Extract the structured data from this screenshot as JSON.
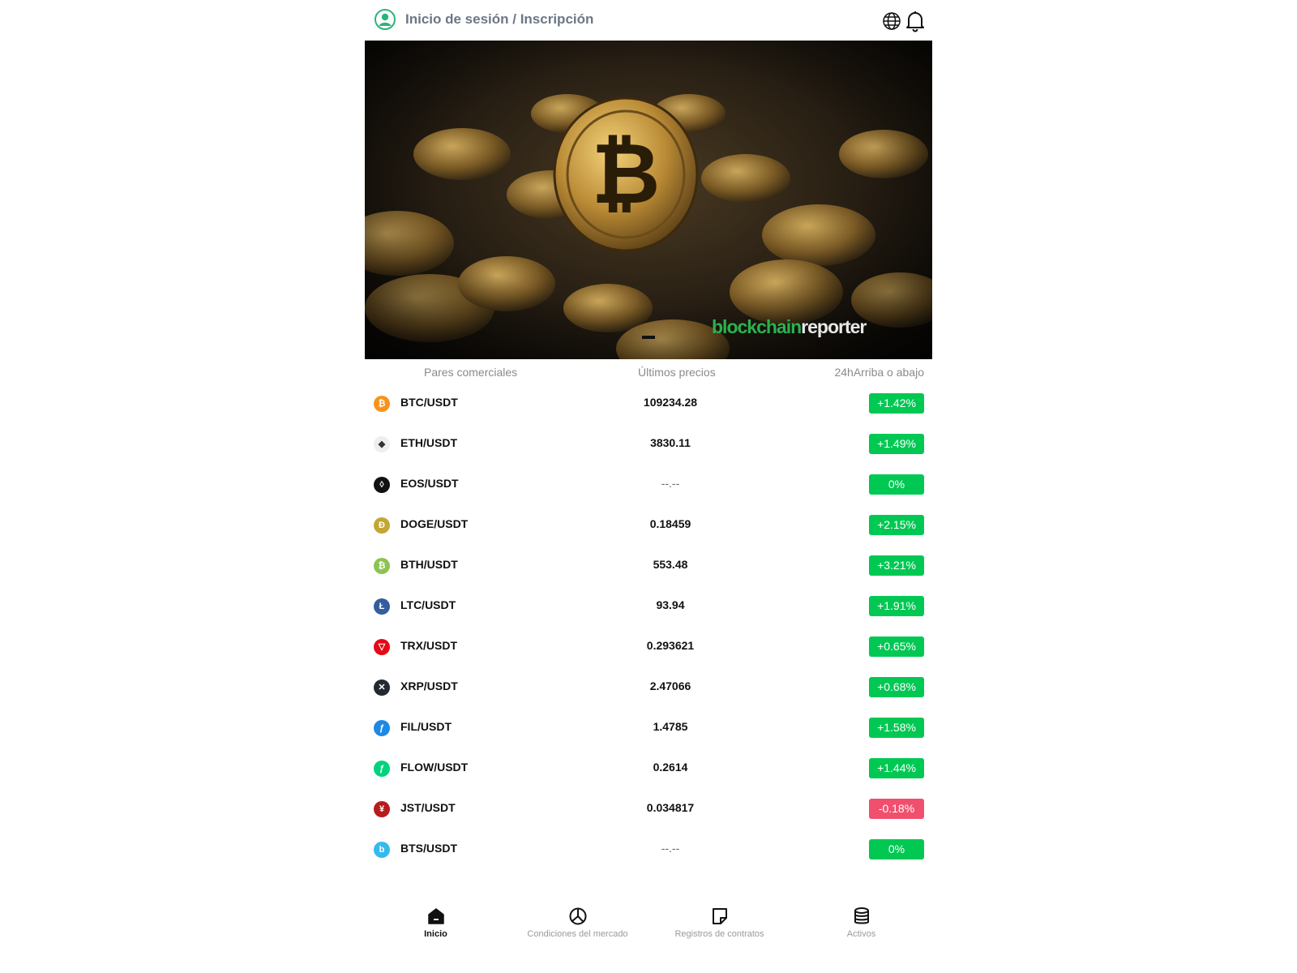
{
  "header": {
    "login_label": "Inicio de sesión / Inscripción",
    "avatar_icon": "user-circle-icon",
    "language_icon": "globe-icon",
    "notifications_icon": "bell-icon"
  },
  "banner": {
    "watermark_part1": "blockchain",
    "watermark_part2": "reporter"
  },
  "table": {
    "col_pair": "Pares comerciales",
    "col_price": "Últimos precios",
    "col_change": "24hArriba o abajo",
    "rows": [
      {
        "pair": "BTC/USDT",
        "price": "109234.28",
        "change": "+1.42%",
        "dir": "up",
        "icon": "bitcoin-icon",
        "glyph": "₿",
        "color": "#f7931a"
      },
      {
        "pair": "ETH/USDT",
        "price": "3830.11",
        "change": "+1.49%",
        "dir": "up",
        "icon": "ethereum-icon",
        "glyph": "◆",
        "color": "#eeeeee"
      },
      {
        "pair": "EOS/USDT",
        "price": "--.--",
        "change": "0%",
        "dir": "up",
        "icon": "eos-icon",
        "glyph": "◊",
        "color": "#111111"
      },
      {
        "pair": "DOGE/USDT",
        "price": "0.18459",
        "change": "+2.15%",
        "dir": "up",
        "icon": "dogecoin-icon",
        "glyph": "Ð",
        "color": "#c3a634"
      },
      {
        "pair": "BTH/USDT",
        "price": "553.48",
        "change": "+3.21%",
        "dir": "up",
        "icon": "bitcoin-cash-icon",
        "glyph": "₿",
        "color": "#8dc351"
      },
      {
        "pair": "LTC/USDT",
        "price": "93.94",
        "change": "+1.91%",
        "dir": "up",
        "icon": "litecoin-icon",
        "glyph": "Ł",
        "color": "#345d9d"
      },
      {
        "pair": "TRX/USDT",
        "price": "0.293621",
        "change": "+0.65%",
        "dir": "up",
        "icon": "tron-icon",
        "glyph": "▽",
        "color": "#e50915"
      },
      {
        "pair": "XRP/USDT",
        "price": "2.47066",
        "change": "+0.68%",
        "dir": "up",
        "icon": "xrp-icon",
        "glyph": "✕",
        "color": "#23292f"
      },
      {
        "pair": "FIL/USDT",
        "price": "1.4785",
        "change": "+1.58%",
        "dir": "up",
        "icon": "filecoin-icon",
        "glyph": "ƒ",
        "color": "#1e88e5"
      },
      {
        "pair": "FLOW/USDT",
        "price": "0.2614",
        "change": "+1.44%",
        "dir": "up",
        "icon": "flow-icon",
        "glyph": "ƒ",
        "color": "#00d37c"
      },
      {
        "pair": "JST/USDT",
        "price": "0.034817",
        "change": "-0.18%",
        "dir": "down",
        "icon": "just-icon",
        "glyph": "¥",
        "color": "#b71c1c"
      },
      {
        "pair": "BTS/USDT",
        "price": "--.--",
        "change": "0%",
        "dir": "up",
        "icon": "bitshares-icon",
        "glyph": "b",
        "color": "#35baeb"
      }
    ]
  },
  "colors": {
    "up": "#00c853",
    "down": "#f0506e"
  },
  "nav": {
    "items": [
      {
        "label": "Inicio",
        "icon": "home-icon",
        "active": true
      },
      {
        "label": "Condiciones del mercado",
        "icon": "pie-chart-icon",
        "active": false
      },
      {
        "label": "Registros de contratos",
        "icon": "note-icon",
        "active": false
      },
      {
        "label": "Activos",
        "icon": "database-icon",
        "active": false
      }
    ]
  }
}
